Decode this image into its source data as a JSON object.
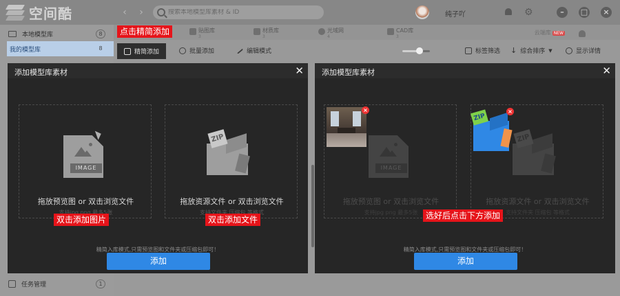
{
  "app": {
    "logo_text": "空间酷",
    "search_placeholder": "搜索本地模型库素材 & ID",
    "username": "纯子吖"
  },
  "sidebar": {
    "items": [
      {
        "label": "本地模型库",
        "count": "8"
      },
      {
        "label": "我的模型库",
        "count": "8"
      }
    ],
    "task": {
      "label": "任务管理",
      "count": "1"
    }
  },
  "lib_tabs": [
    {
      "label": "贴图库",
      "sub": "3"
    },
    {
      "label": "材质库",
      "sub": "3"
    },
    {
      "label": "光域网",
      "sub": "4"
    },
    {
      "label": "CAD库",
      "sub": "3"
    }
  ],
  "cloud": {
    "label": "云端库",
    "badge": "NEW"
  },
  "toolbar": {
    "quick_add": "精简添加",
    "batch_add": "批量添加",
    "edit_mode": "编辑模式",
    "tag_filter": "标签筛选",
    "sort": "综合排序",
    "show_detail": "显示详情",
    "zoom_fraction": 0.62
  },
  "callouts": {
    "top": "点击精简添加",
    "image": "双击添加图片",
    "file": "双击添加文件",
    "after": "选好后点击下方添加"
  },
  "dialog": {
    "title": "添加模型库素材",
    "drop_image_main": "拖放预览图 or 双击浏览文件",
    "drop_image_sub": "支持jpg png 最多5张",
    "drop_file_main": "拖放资源文件 or 双击浏览文件",
    "drop_file_sub": "支持文件夹 压缩包 等格式",
    "image_tag": "IMAGE",
    "zip_tag": "ZIP",
    "hint": "精简入库模式,只需预览图和文件夹或压缩包即可！",
    "add_button": "添加"
  },
  "colors": {
    "accent": "#2f88e5",
    "callout": "#e6141a",
    "dialog_bg": "#262626"
  }
}
